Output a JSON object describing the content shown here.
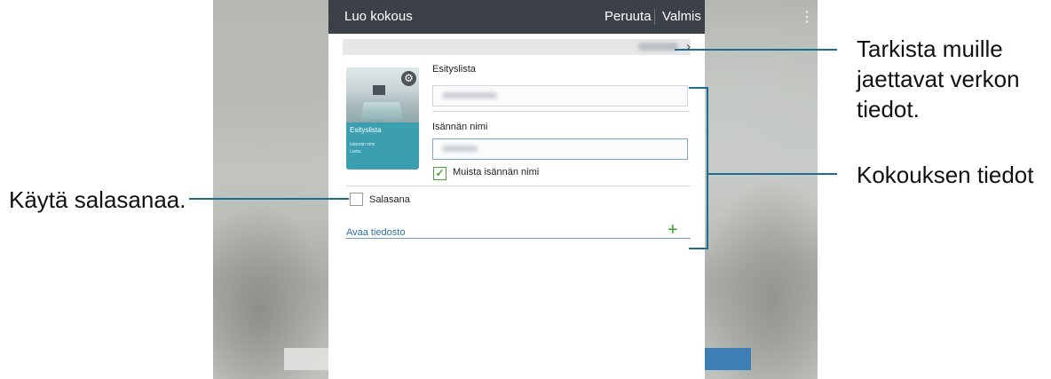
{
  "dialog": {
    "title": "Luo kokous",
    "cancel_label": "Peruuta",
    "done_label": "Valmis"
  },
  "cover": {
    "title": "Esityslista",
    "host_line": "Isännän nimi",
    "created_line": "Luotu"
  },
  "form": {
    "agenda_label": "Esityslista",
    "host_label": "Isännän nimi",
    "remember_label": "Muista isännän nimi",
    "remember_checked": true,
    "password_label": "Salasana",
    "password_checked": false,
    "open_file_label": "Avaa tiedosto"
  },
  "callouts": {
    "network": [
      "Tarkista muille",
      "jaettavat verkon",
      "tiedot."
    ],
    "meeting": "Kokouksen tiedot",
    "password": "Käytä salasanaa."
  },
  "colors": {
    "accent_line": "#1d6d8c",
    "title_bar": "#3c4148",
    "cover": "#3c9faf",
    "check": "#4e9e3b"
  },
  "icons": {
    "settings": "gear-icon",
    "more": "overflow-menu-icon",
    "expand": "chevron-right-icon",
    "add": "plus-icon",
    "check": "checkmark-icon"
  }
}
